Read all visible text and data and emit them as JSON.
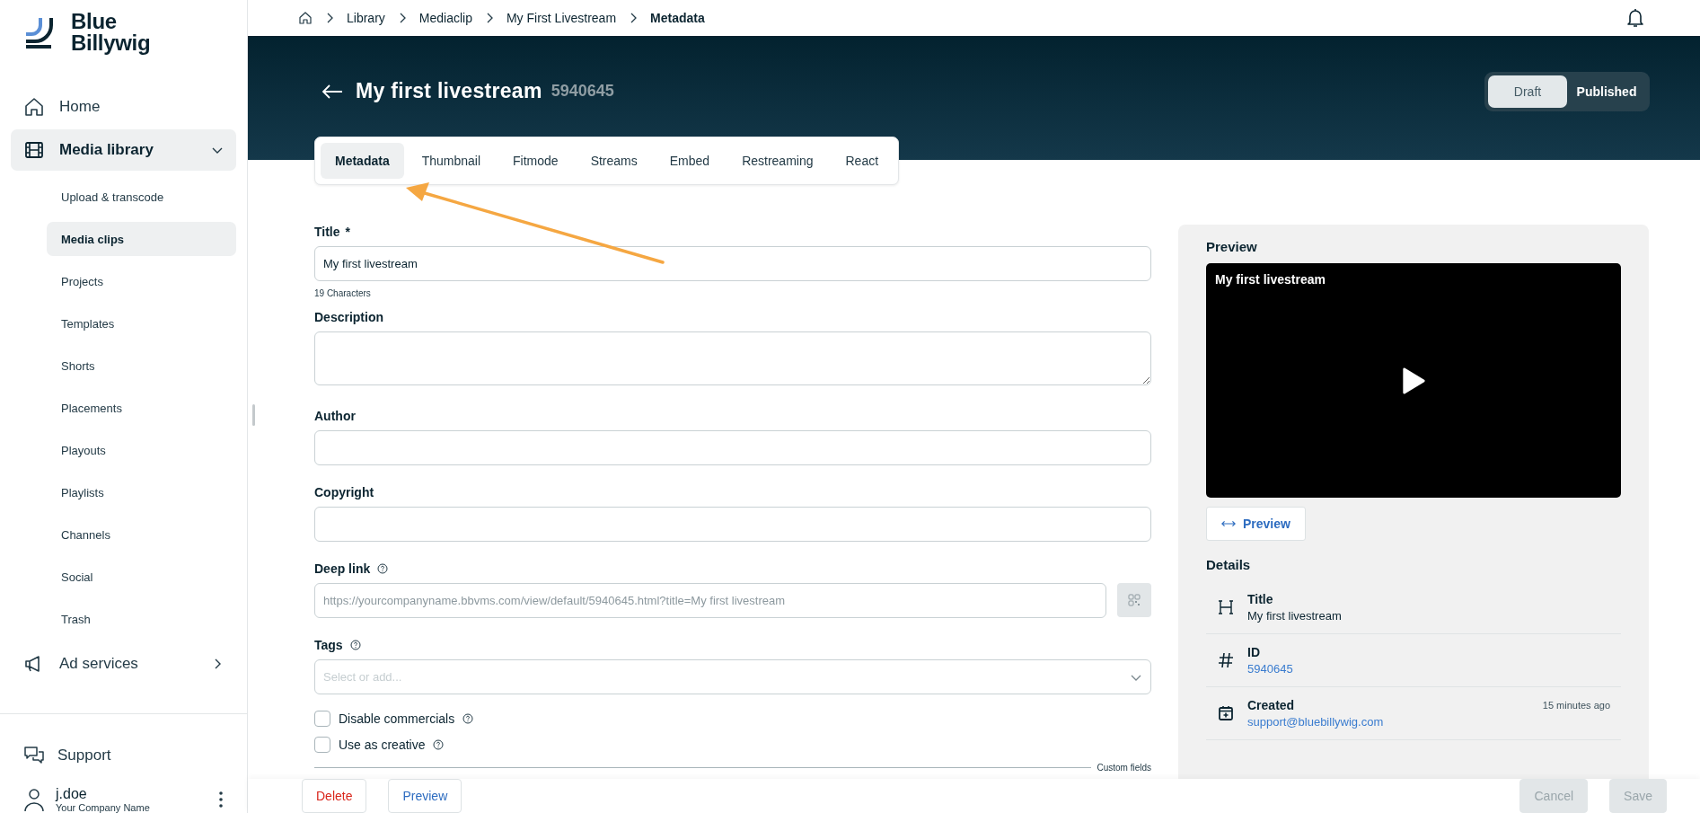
{
  "logo": {
    "line1": "Blue",
    "line2": "Billywig"
  },
  "nav": [
    {
      "label": "Home",
      "selected": false
    },
    {
      "label": "Media library",
      "selected": true,
      "expanded": true,
      "children": [
        {
          "label": "Upload & transcode",
          "selected": false
        },
        {
          "label": "Media clips",
          "selected": true
        },
        {
          "label": "Projects",
          "selected": false
        },
        {
          "label": "Templates",
          "selected": false
        },
        {
          "label": "Shorts",
          "selected": false
        },
        {
          "label": "Placements",
          "selected": false
        },
        {
          "label": "Playouts",
          "selected": false
        },
        {
          "label": "Playlists",
          "selected": false
        },
        {
          "label": "Channels",
          "selected": false
        },
        {
          "label": "Social",
          "selected": false
        },
        {
          "label": "Trash",
          "selected": false
        }
      ]
    },
    {
      "label": "Ad services",
      "selected": false,
      "expanded": false
    }
  ],
  "support": {
    "label": "Support"
  },
  "user": {
    "name": "j.doe",
    "company": "Your Company Name"
  },
  "breadcrumb": [
    "Library",
    "Mediaclip",
    "My First Livestream",
    "Metadata"
  ],
  "header": {
    "title": "My first livestream",
    "id": "5940645"
  },
  "status_toggle": [
    {
      "label": "Draft",
      "selected": true
    },
    {
      "label": "Published",
      "selected": false
    }
  ],
  "tabs": [
    {
      "label": "Metadata",
      "selected": true
    },
    {
      "label": "Thumbnail",
      "selected": false
    },
    {
      "label": "Fitmode",
      "selected": false
    },
    {
      "label": "Streams",
      "selected": false
    },
    {
      "label": "Embed",
      "selected": false
    },
    {
      "label": "Restreaming",
      "selected": false
    },
    {
      "label": "React",
      "selected": false
    }
  ],
  "fields": [
    {
      "kind": "text",
      "label": "Title",
      "required_mark": "*",
      "value": "My first livestream",
      "hint": "19 Characters"
    },
    {
      "kind": "textarea",
      "label": "Description"
    },
    {
      "kind": "text",
      "label": "Author"
    },
    {
      "kind": "text",
      "label": "Copyright"
    },
    {
      "kind": "link",
      "label": "Deep link",
      "help": true,
      "placeholder": "https://yourcompanyname.bbvms.com/view/default/5940645.html?title=My first livestream"
    },
    {
      "kind": "select",
      "label": "Tags",
      "help": true,
      "placeholder": "Select or add..."
    },
    {
      "kind": "checkbox",
      "label": "Disable commercials",
      "help": true,
      "checked": false
    },
    {
      "kind": "checkbox",
      "label": "Use as creative",
      "help": true,
      "checked": false
    }
  ],
  "custom_fields_label": "Custom fields",
  "preview": {
    "heading": "Preview",
    "video_title": "My first livestream",
    "button": "Preview"
  },
  "details": {
    "heading": "Details",
    "rows": [
      {
        "kind": "heading",
        "label": "Title",
        "value": "My first livestream",
        "link": false
      },
      {
        "kind": "hash",
        "label": "ID",
        "value": "5940645",
        "link": true
      },
      {
        "kind": "calendar",
        "label": "Created",
        "value": "support@bluebillywig.com",
        "link": true,
        "time": "15 minutes ago"
      }
    ]
  },
  "actions": [
    {
      "kind": "danger",
      "label": "Delete",
      "disabled": false
    },
    {
      "kind": "secondary",
      "label": "Preview",
      "disabled": false
    },
    {
      "kind": "spacer"
    },
    {
      "kind": "plain",
      "label": "Cancel",
      "disabled": true
    },
    {
      "kind": "plain",
      "label": "Save",
      "disabled": true
    }
  ]
}
